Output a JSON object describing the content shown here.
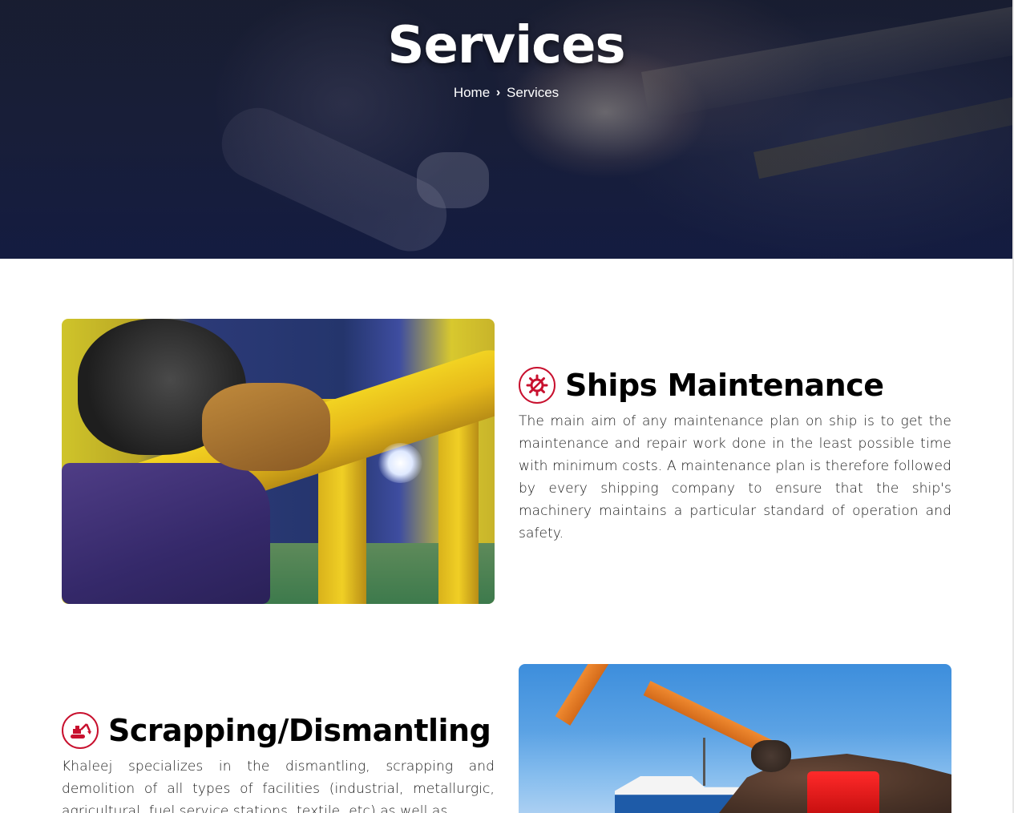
{
  "hero": {
    "title": "Services",
    "breadcrumb": {
      "home": "Home",
      "separator": "›",
      "current": "Services"
    }
  },
  "services": [
    {
      "title": "Ships Maintenance",
      "icon": "wrench-gear-icon",
      "description": "The main aim of any maintenance plan on ship is to get the maintenance and repair work done in the least possible time with minimum costs. A maintenance plan is therefore followed by every shipping company to ensure that the ship's machinery maintains a particular standard of operation and safety.",
      "image": "welding-photo"
    },
    {
      "title": "Scrapping/Dismantling",
      "icon": "excavator-icon",
      "description": "Khaleej specializes in the dismantling, scrapping and demolition of all types of facilities (industrial, metallurgic, agricultural, fuel service stations, textile, etc) as well as",
      "image": "scrap-yard-photo"
    }
  ],
  "colors": {
    "accent": "#c8102e",
    "hero_overlay": "#1a2036",
    "text": "#1a1a1a"
  }
}
